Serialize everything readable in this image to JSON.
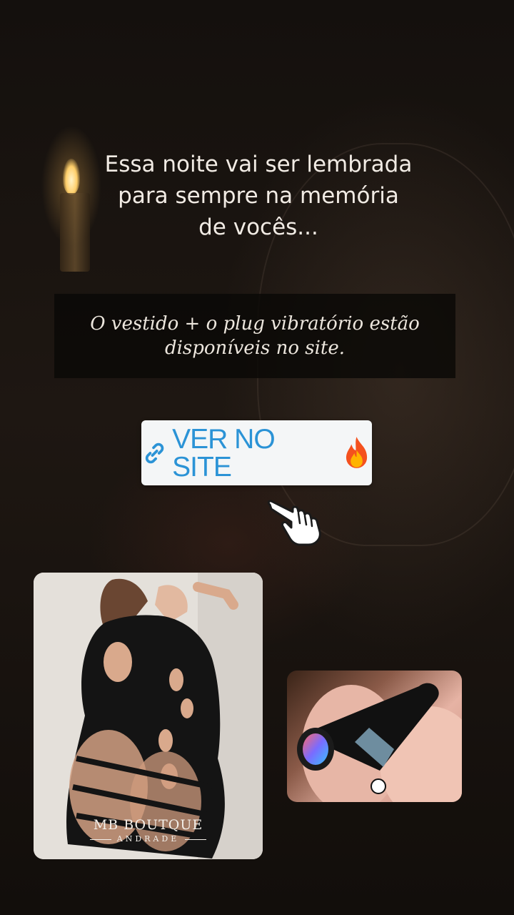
{
  "story": {
    "headline_lines": [
      "Essa noite vai ser lembrada",
      "para sempre na memória",
      "de vocês..."
    ],
    "subtext_lines": [
      "O vestido + o plug vibratório estão",
      "disponíveis no site."
    ],
    "link_sticker": {
      "label": "VER NO SITE",
      "icon": "link-icon",
      "emoji": "fire-icon"
    },
    "pointer": "pointing-hand-icon",
    "photos": [
      {
        "name": "dress-photo",
        "brand": "MB BOUTQUE",
        "brand_sub": "ANDRADE"
      },
      {
        "name": "plug-photo"
      }
    ]
  },
  "colors": {
    "link_text": "#2b93d6",
    "sticker_bg": "#f4f6f7",
    "headline_text": "#f1ebe4"
  }
}
